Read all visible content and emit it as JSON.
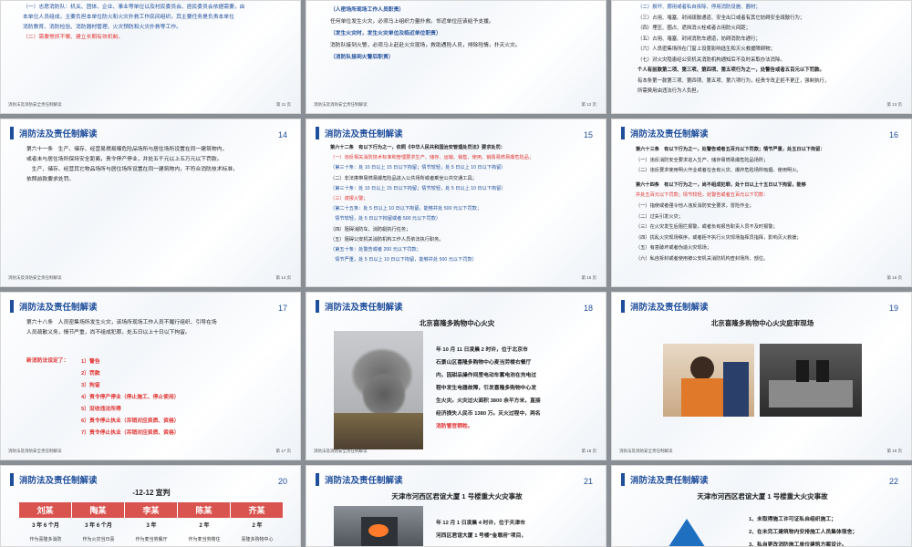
{
  "common": {
    "title": "消防法及责任制解读",
    "footer": "消防法及消防安全责任制解读"
  },
  "slide11": {
    "lines": [
      "（一）志愿消防队：机关、团体、企业、事业等单位以及村民委员会、居民委员会依据需要，由",
      "本单位人员组成，主要负担本单位防火和火灾扑救工作民间组织。其主要任务是负责本单位",
      "消防教育、消防检验、消防器材管理、火灾预防和火灾扑救等工作。",
      "（二）需要常抓不懈、建立长期有效机制。"
    ],
    "page": "第 11 页"
  },
  "slide12": {
    "lines": [
      "（人密场所现场工作人员职责）",
      "任何单位发生火灾，必须马上组织力量扑救。邻近单位应该给予支援。",
      "（发生火灾时，发生火灾单位及临近单位职责）",
      "消防队接到火警，必须马上赶赴火灾现场，救助遇险人员，排除险情，扑灭火灾。",
      "（消防队接到火警后职责）"
    ],
    "page": "第 12 页"
  },
  "slide13": {
    "lines": [
      "（二）损坏、挪用或者私自拆除、停用消防设施、器材；",
      "（三）占用、堵塞、封闭疏散通道、安全出口或者有其它妨碍安全疏散行为；",
      "（四）埋压、圈占、遮挡消火栓或者占用防火间距；",
      "（五）占用、堵塞、封闭消防车通道，妨碍消防车通行；",
      "（六）人员密集场所在门窗上设置影响逃生和灭火救援障碍物；",
      "（七）对火灾隐患经公安机关消防机构通知后不及时采取办法消除。",
      "个人有前款第二项、第三项、第四项、第五项行为之一，处警告或者五百元以下罚款。",
      "有本条第一款第三项、第四项、第五项、第六项行为，经责令改正拒不更正，强制执行，",
      "所需费用由违法行为人负担。"
    ],
    "page": "第 13 页"
  },
  "slide14": {
    "num": "14",
    "lines": [
      "第六十一条　生产、储存、经营易燃易爆危险品场所与居住场所设置在同一建筑物内，",
      "或者未与居住场所保持安全距离，责令停产停业，并处五千元以上五万元以下罚款。",
      "　生产、储存、经营其它物品场所与居住场所设置在同一建筑物内，不符合消防技术标准，",
      "依照前款要求处罚。"
    ],
    "page": "第 14 页"
  },
  "slide15": {
    "num": "15",
    "lines": [
      "第六十二条　有以下行为之一，依照《中华人民共和国治安管理处罚法》要求处罚：",
      "（一）违反相关消防技术标准和管理要求生产、储存、运输、销售、使用、销毁易燃易爆危险品；",
      "（第三十条：处 10 日以上 15 日以下拘留；情节较轻，处 5 日以上 10 日以下拘留）",
      "（二）非法携带易燃易爆危险品进入公共场所或者乘坐公共交通工具；",
      "（第三十条：处 10 日以上 15 日以下拘留；情节较轻，处 5 日以上 10 日以下拘留）",
      "（三）谎报火警；",
      "（第二十五条：处 5 日以上 10 日以下拘留，能够并处 500 元以下罚款；",
      "　情节较轻，处 5 日以下拘留或者 500 元以下罚款）",
      "（四）阻碍消防车、消防艇执行任务；",
      "（五）阻碍公安机关消防机构工作人员依法执行职务。",
      "（第五十条：处警告或者 200 元以下罚款；",
      "　情节严重，处 5 日以上 10 日以下拘留，能够并处 500 元以下罚款）"
    ],
    "page": "第 15 页"
  },
  "slide16": {
    "num": "16",
    "lines": [
      "第六十三条　有以下行为之一，处警告或者五百元以下罚款；情节严重，处五日以下拘留：",
      "（一）违反消防安全要求进入生产、储存易燃易爆危险品场所；",
      "（二）违反要求使用明火作业或者在含有火灾、爆炸危险场所吸烟、使用明火。",
      "第六十四条　有以下行为之一，尚不组成犯罪，处十日以上十五日以下拘留，能够",
      "并处五百元以下罚款；情节较轻，处警告或者五百元以下罚款：",
      "（一）指使或者强令他人违反消防安全要求，冒险作业；",
      "（二）过失引发火灾；",
      "（三）在火灾发生后阻拦报警，或者负有报告职责人员不及时报警；",
      "（四）扰乱火灾现场秩序，或者拒不执行火灾现场指挥员指挥，影响灭火救援；",
      "（五）有意破坏或者伪造火灾现场；",
      "（六）私自拆封或者使用被公安机关消防机构查封场所、部位。"
    ],
    "page": "第 16 页"
  },
  "slide17": {
    "num": "17",
    "lines": [
      "第六十八条　人员密集场所发生火灾，该场所现场工作人员不履行组织、引导在场",
      "人员疏散义务，情节严重，尚不组成犯罪，处五日以上十日以下拘留。"
    ],
    "heading": "新消防法设定了：",
    "items": [
      "1）警告",
      "2）罚款",
      "3）拘留",
      "4）责令停产停业（停止施工、停止使用）",
      "5）没收违法所得",
      "6）责令停止执业（吊销对应资质、资格）",
      "7）责令停止执业（吊销对应资质、资格）"
    ],
    "page": "第 17 页"
  },
  "slide18": {
    "num": "18",
    "heading": "北京喜隆多购物中心火灾",
    "lines": [
      "年 10 月 11 日凌晨 2 时许，位于北京市",
      "石景山区喜隆多购物中心麦当劳楼右餐厅",
      "内，因甜品操作间里电动车蓄电池在充电过",
      "程中发生电器故障，引发喜隆多购物中心发",
      "生火灾。火灾过火面积 3800 余平方米，直接",
      "经济损失人民币 1380 万。灭火过程中，两名",
      "消防管官牺牲。"
    ],
    "page": "第 18 页"
  },
  "slide19": {
    "num": "19",
    "heading": "北京喜隆多购物中心火灾庭审现场",
    "page": "第 19 页"
  },
  "slide20": {
    "num": "20",
    "heading": "-12-12 宣判",
    "names": [
      "刘某",
      "陶某",
      "李某",
      "陈某",
      "齐某"
    ],
    "terms": [
      "3 年 6 个月",
      "3 年 6 个月",
      "3 年",
      "2 年",
      "2 年"
    ],
    "roles": [
      "作为喜隆多消防",
      "作为火灾当日喜",
      "作为麦当劳餐厅",
      "作为麦当劳楼住",
      "喜隆多购物中心"
    ]
  },
  "slide21": {
    "num": "21",
    "heading": "天津市河西区君谊大厦 1 号楼重大火灾事故",
    "lines": [
      "年 12 月 1 日凌晨 4 时许，位于天津市",
      "河西区君谊大厦 1 号楼“金尊府”项目，"
    ]
  },
  "slide22": {
    "num": "22",
    "heading": "天津市河西区君谊大厦 1 号楼重大火灾事故",
    "lines": [
      "1、未取得施工许可证私自组织施工；",
      "2、在未完工建筑物内安排施工人员集体宿舍；",
      "3、私自更改消防施工单位建筑方案设计。"
    ]
  }
}
